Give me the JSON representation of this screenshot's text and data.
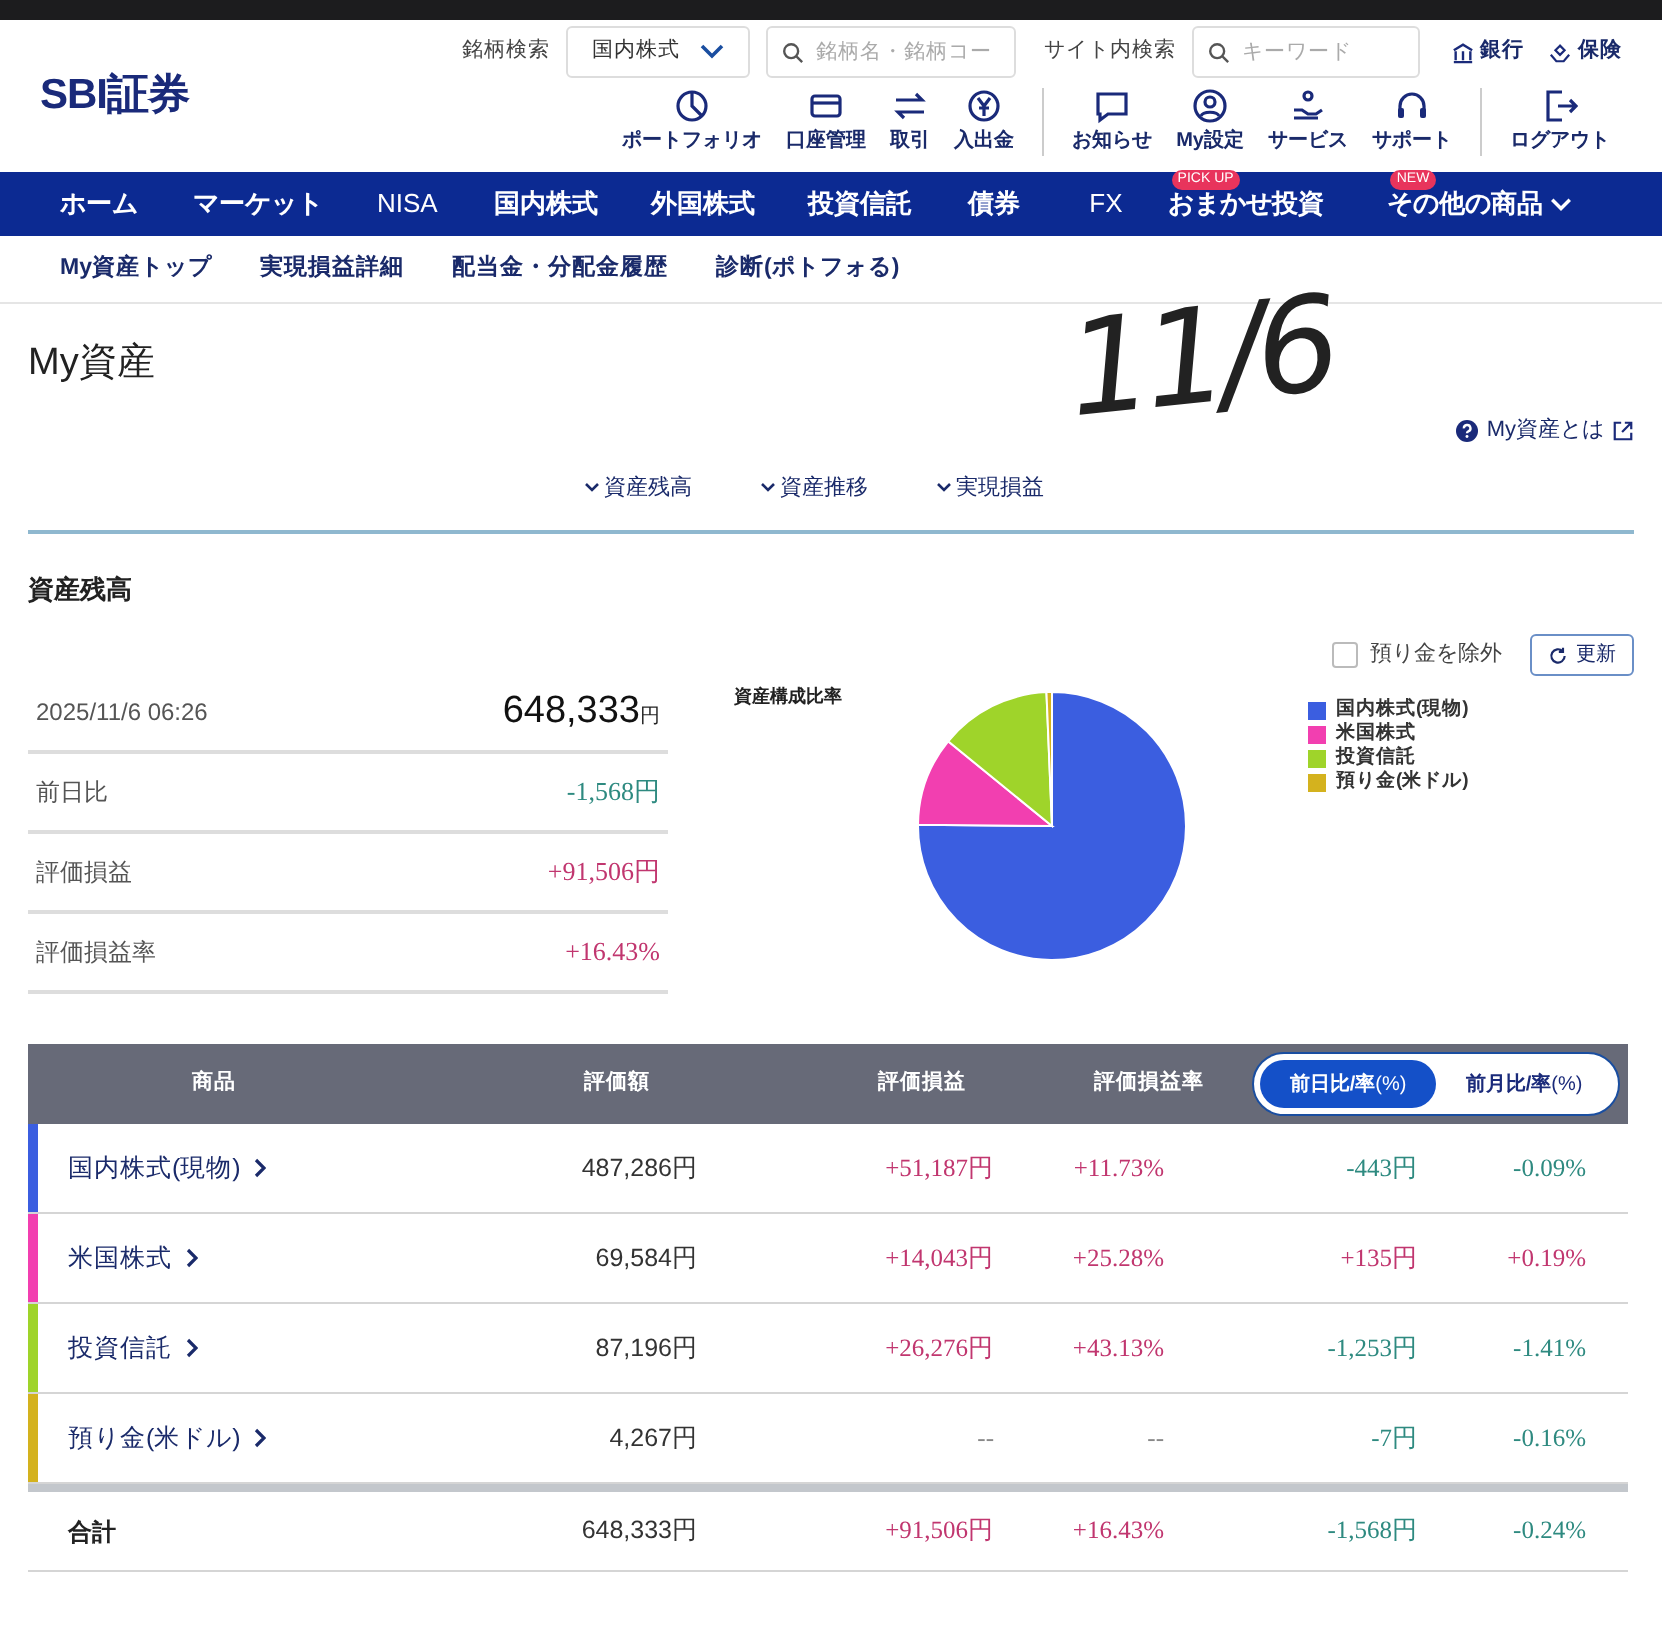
{
  "header": {
    "logo": "SBI証券",
    "stock_search": {
      "label": "銘柄検索",
      "market": "国内株式",
      "placeholder": "銘柄名・銘柄コー"
    },
    "site_search": {
      "label": "サイト内検索",
      "placeholder": "キーワード"
    },
    "links": [
      {
        "kind": "bank",
        "label": "銀行"
      },
      {
        "kind": "insurance",
        "label": "保険"
      }
    ],
    "icon_menu": [
      {
        "kind": "pie",
        "label": "ポートフォリオ"
      },
      {
        "kind": "card",
        "label": "口座管理"
      },
      {
        "kind": "arrows",
        "label": "取引"
      },
      {
        "kind": "yen",
        "label": "入出金"
      },
      {
        "kind": "chat",
        "label": "お知らせ"
      },
      {
        "kind": "user",
        "label": "My設定"
      },
      {
        "kind": "service",
        "label": "サービス"
      },
      {
        "kind": "headset",
        "label": "サポート"
      },
      {
        "kind": "logout",
        "label": "ログアウト"
      }
    ]
  },
  "nav": [
    {
      "label": "ホーム",
      "bold": true
    },
    {
      "label": "マーケット",
      "bold": true
    },
    {
      "label": "NISA",
      "bold": false
    },
    {
      "label": "国内株式",
      "bold": true
    },
    {
      "label": "外国株式",
      "bold": true
    },
    {
      "label": "投資信託",
      "bold": true
    },
    {
      "label": "債券",
      "bold": true
    },
    {
      "label": "FX",
      "bold": false
    },
    {
      "label": "おまかせ投資",
      "bold": true,
      "badge": "PICK UP"
    },
    {
      "label": "その他の商品",
      "bold": true,
      "badge": "NEW",
      "dropdown": true
    }
  ],
  "subnav": [
    "My資産トップ",
    "実現損益詳細",
    "配当金・分配金履歴",
    "診断(ポトフォる)"
  ],
  "page_title": "My資産",
  "handwritten_note": "11/6",
  "help_link": "My資産とは",
  "anchors": [
    "資産残高",
    "資産推移",
    "実現損益"
  ],
  "section_title": "資産残高",
  "exclude_deposit": {
    "label": "預り金を除外",
    "checked": false
  },
  "refresh_button": "更新",
  "summary": {
    "timestamp": "2025/11/6 06:26",
    "total": "648,333",
    "unit": "円",
    "rows": [
      {
        "label": "前日比",
        "value": "-1,568円",
        "color": "#2e8a80"
      },
      {
        "label": "評価損益",
        "value": "+91,506円",
        "color": "#c1366f"
      },
      {
        "label": "評価損益率",
        "value": "+16.43%",
        "color": "#c1366f"
      }
    ]
  },
  "chart": {
    "title": "資産構成比率",
    "chart_data": {
      "type": "pie",
      "categories": [
        "国内株式(現物)",
        "米国株式",
        "投資信託",
        "預り金(米ドル)"
      ],
      "values": [
        75.16,
        10.73,
        13.45,
        0.66
      ],
      "colors": [
        "#3b5ee0",
        "#f23fb0",
        "#9fd42a",
        "#d4b21e"
      ]
    }
  },
  "table": {
    "columns": [
      "商品",
      "評価額",
      "評価損益",
      "評価損益率"
    ],
    "toggle": [
      {
        "label": "**前日比/率**(%)",
        "selected": true
      },
      {
        "label": "**前月比/率**(%)",
        "selected": false
      }
    ],
    "rows": [
      {
        "color": "#3b5ee0",
        "cells": [
          {
            "text": "国内株式(現物)",
            "kind": "link"
          },
          {
            "text": "487,286円",
            "kind": "plain"
          },
          {
            "text": "+51,187円",
            "color": "#c1366f"
          },
          {
            "text": "+11.73%",
            "color": "#c1366f"
          },
          {
            "text": "-443円",
            "color": "#2e8a80"
          },
          {
            "text": "-0.09%",
            "color": "#2e8a80"
          }
        ]
      },
      {
        "color": "#f23fb0",
        "cells": [
          {
            "text": "米国株式",
            "kind": "link"
          },
          {
            "text": "69,584円",
            "kind": "plain"
          },
          {
            "text": "+14,043円",
            "color": "#c1366f"
          },
          {
            "text": "+25.28%",
            "color": "#c1366f"
          },
          {
            "text": "+135円",
            "color": "#c1366f"
          },
          {
            "text": "+0.19%",
            "color": "#c1366f"
          }
        ]
      },
      {
        "color": "#9fd42a",
        "cells": [
          {
            "text": "投資信託",
            "kind": "link"
          },
          {
            "text": "87,196円",
            "kind": "plain"
          },
          {
            "text": "+26,276円",
            "color": "#c1366f"
          },
          {
            "text": "+43.13%",
            "color": "#c1366f"
          },
          {
            "text": "-1,253円",
            "color": "#2e8a80"
          },
          {
            "text": "-1.41%",
            "color": "#2e8a80"
          }
        ]
      },
      {
        "color": "#d4b21e",
        "cells": [
          {
            "text": "預り金(米ドル)",
            "kind": "link"
          },
          {
            "text": "4,267円",
            "kind": "plain"
          },
          {
            "text": "--",
            "color": "#888888"
          },
          {
            "text": "--",
            "color": "#888888"
          },
          {
            "text": "-7円",
            "color": "#2e8a80"
          },
          {
            "text": "-0.16%",
            "color": "#2e8a80"
          }
        ]
      }
    ],
    "total": {
      "cells": [
        {
          "text": "合計",
          "kind": "label"
        },
        {
          "text": "648,333円",
          "kind": "plain"
        },
        {
          "text": "+91,506円",
          "color": "#c1366f"
        },
        {
          "text": "+16.43%",
          "color": "#c1366f"
        },
        {
          "text": "-1,568円",
          "color": "#2e8a80"
        },
        {
          "text": "-0.24%",
          "color": "#2e8a80"
        }
      ]
    }
  }
}
